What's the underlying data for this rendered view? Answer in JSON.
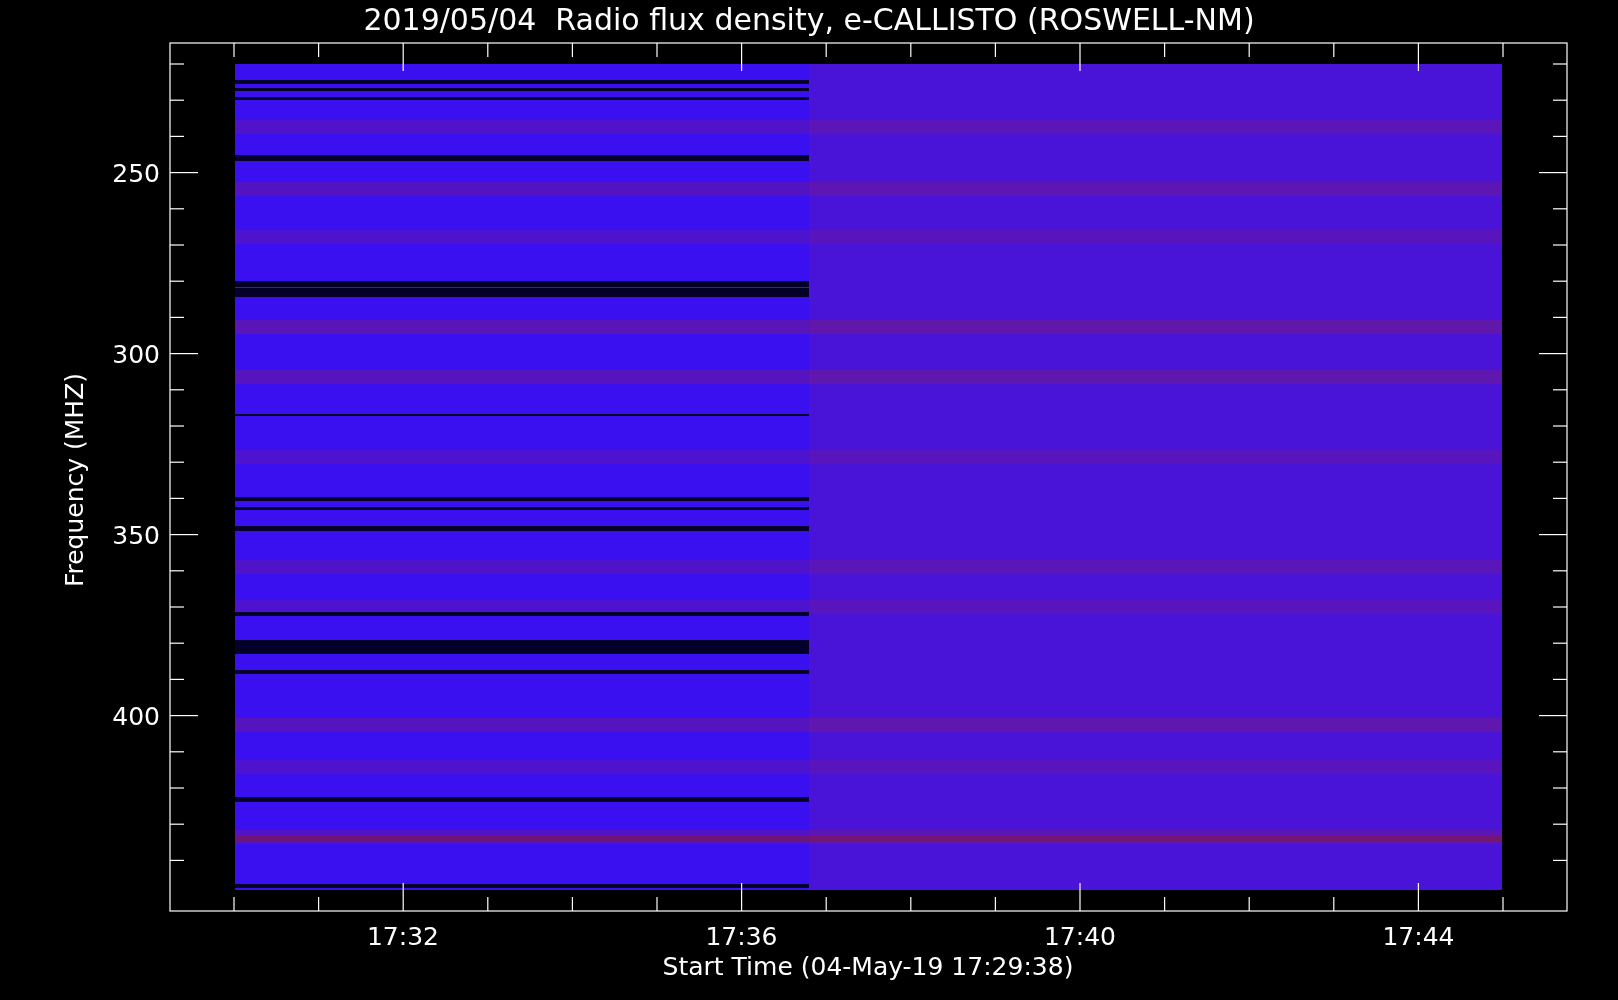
{
  "title": "2019/05/04  Radio flux density, e-CALLISTO (ROSWELL-NM)",
  "y_axis": {
    "label": "Frequency (MHZ)",
    "ticks": [
      "250",
      "300",
      "350",
      "400"
    ]
  },
  "x_axis": {
    "label": "Start Time (04-May-19 17:29:38)",
    "ticks": [
      "17:32",
      "17:36",
      "17:40",
      "17:44"
    ]
  }
}
